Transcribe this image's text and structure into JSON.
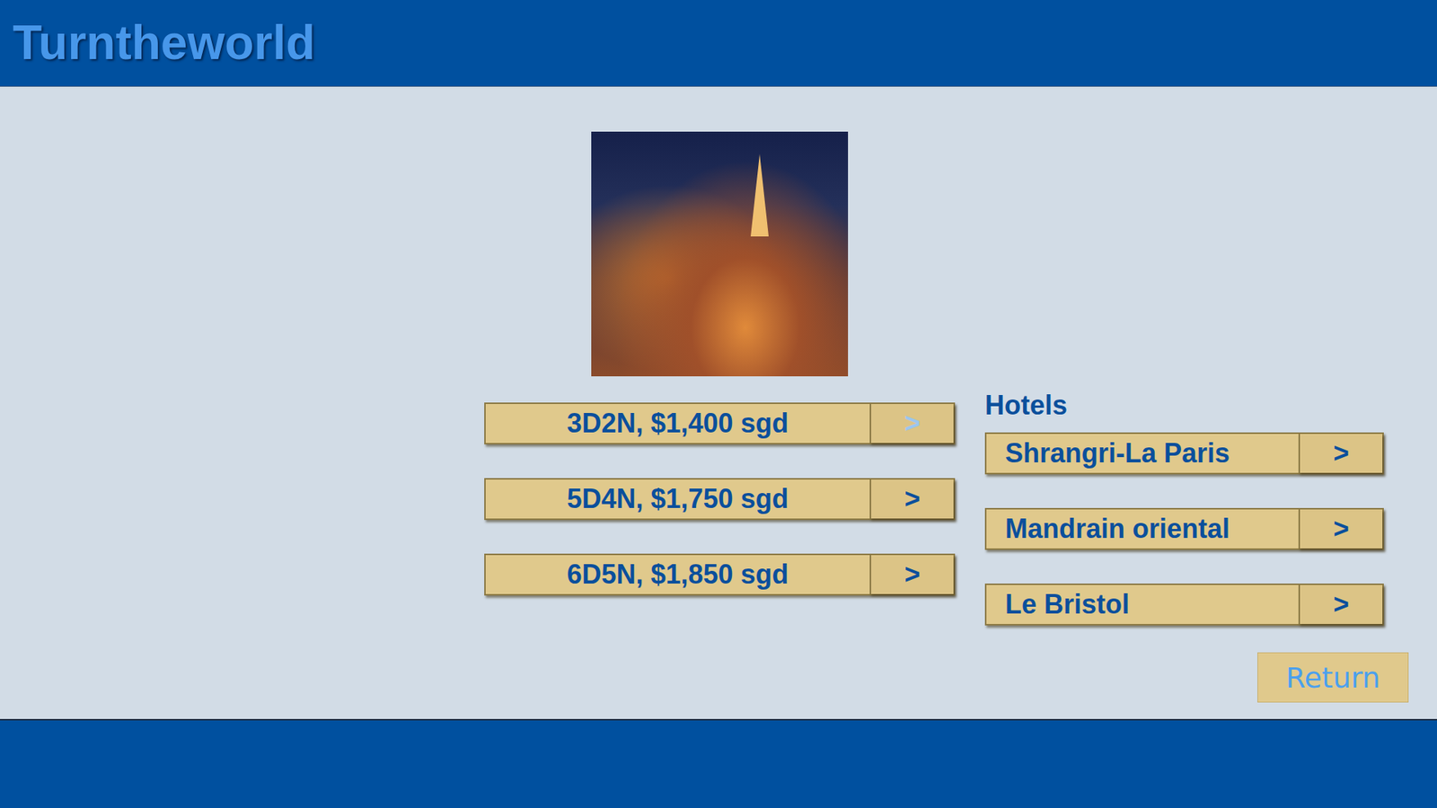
{
  "header": {
    "title": "Turntheworld"
  },
  "packages": [
    {
      "label": "3D2N, $1,400 sgd",
      "arrow": ">",
      "dimmed": true
    },
    {
      "label": "5D4N, $1,750 sgd",
      "arrow": ">",
      "dimmed": false
    },
    {
      "label": "6D5N, $1,850 sgd",
      "arrow": ">",
      "dimmed": false
    }
  ],
  "hotels": {
    "title": "Hotels",
    "items": [
      {
        "label": "Shrangri-La Paris",
        "arrow": ">"
      },
      {
        "label": "Mandrain oriental",
        "arrow": ">"
      },
      {
        "label": "Le Bristol",
        "arrow": ">"
      }
    ]
  },
  "return_button": "Return"
}
